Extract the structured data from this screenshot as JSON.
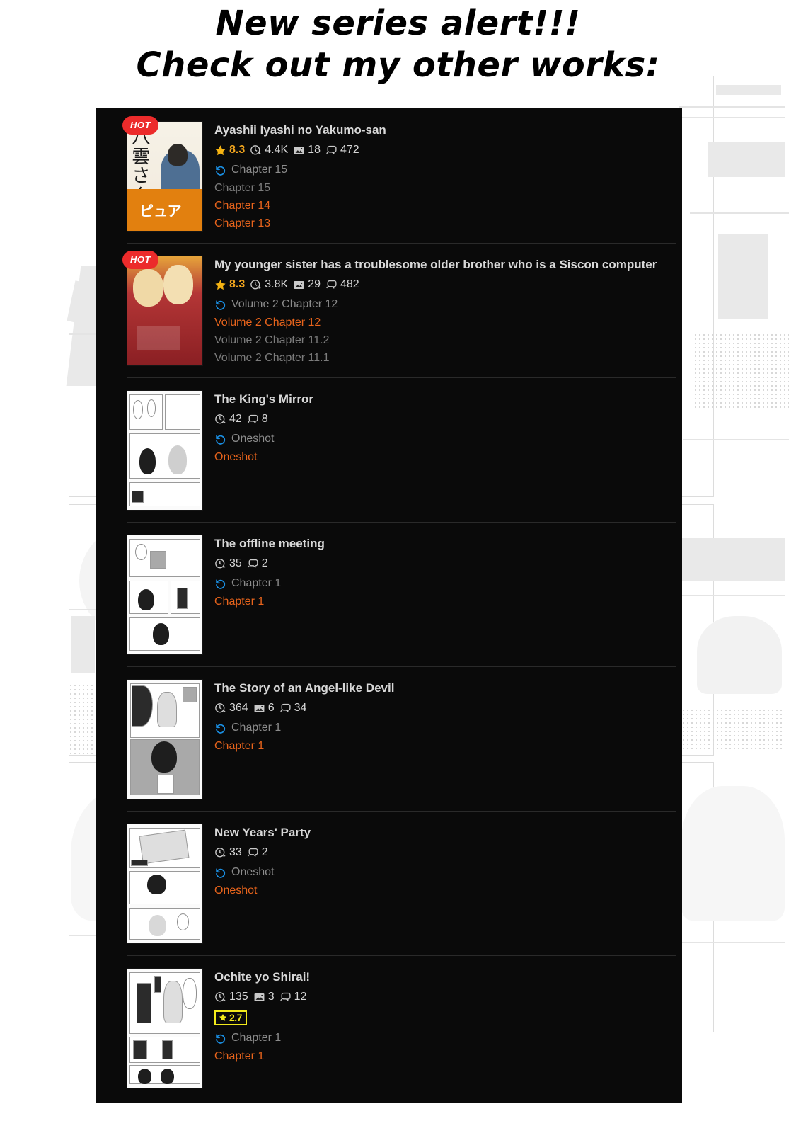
{
  "header": {
    "line1": "New series alert!!!",
    "line2": "Check out my other works:"
  },
  "colors": {
    "panel_bg": "#0a0a0a",
    "accent_orange": "#e8641c",
    "rating_yellow": "#f0a41e",
    "hot_red": "#ec2b2b",
    "history_blue": "#1a8fe3",
    "muted_text": "#8c8c8c",
    "title_text": "#d8d8d8",
    "chip_yellow": "#f2ea1b"
  },
  "icons": {
    "star": "star-icon",
    "views": "views-icon",
    "images": "images-icon",
    "comments": "comments-icon",
    "history": "history-icon",
    "hot": "hot-badge"
  },
  "entries": [
    {
      "title": "Ayashii Iyashi no Yakumo-san",
      "hot": "HOT",
      "rating": "8.3",
      "views": "4.4K",
      "images": "18",
      "comments": "472",
      "latest": "Chapter 15",
      "chapters": [
        {
          "label": "Chapter 15",
          "state": "read"
        },
        {
          "label": "Chapter 14",
          "state": "unread"
        },
        {
          "label": "Chapter 13",
          "state": "unread"
        }
      ]
    },
    {
      "title": "My younger sister has a troublesome older brother who is a Siscon computer",
      "hot": "HOT",
      "rating": "8.3",
      "views": "3.8K",
      "images": "29",
      "comments": "482",
      "latest": "Volume 2 Chapter 12",
      "chapters": [
        {
          "label": "Volume 2 Chapter 12",
          "state": "unread"
        },
        {
          "label": "Volume 2 Chapter 11.2",
          "state": "read"
        },
        {
          "label": "Volume 2 Chapter 11.1",
          "state": "read"
        }
      ]
    },
    {
      "title": "The King's Mirror",
      "views": "42",
      "comments": "8",
      "latest": "Oneshot",
      "chapters": [
        {
          "label": "Oneshot",
          "state": "unread"
        }
      ]
    },
    {
      "title": "The offline meeting",
      "views": "35",
      "comments": "2",
      "latest": "Chapter 1",
      "chapters": [
        {
          "label": "Chapter 1",
          "state": "unread"
        }
      ]
    },
    {
      "title": "The Story of an Angel-like Devil",
      "views": "364",
      "images": "6",
      "comments": "34",
      "latest": "Chapter 1",
      "chapters": [
        {
          "label": "Chapter 1",
          "state": "unread"
        }
      ]
    },
    {
      "title": "New Years' Party",
      "views": "33",
      "comments": "2",
      "latest": "Oneshot",
      "chapters": [
        {
          "label": "Oneshot",
          "state": "unread"
        }
      ]
    },
    {
      "title": "Ochite yo Shirai!",
      "views": "135",
      "images": "3",
      "comments": "12",
      "chip_rating": "2.7",
      "latest": "Chapter 1",
      "chapters": [
        {
          "label": "Chapter 1",
          "state": "unread"
        }
      ]
    }
  ]
}
